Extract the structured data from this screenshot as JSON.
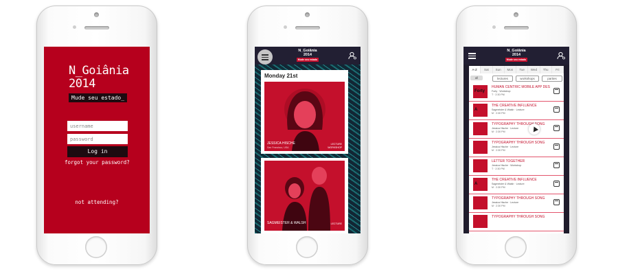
{
  "login": {
    "brand_line1": "N_Goiânia",
    "brand_line2": "2014",
    "tagline": "Mude seu estado_",
    "username_placeholder": "username",
    "password_placeholder": "password",
    "login_label": "Log in",
    "forgot_label": "forgot your password?",
    "not_attending_label": "not attending?"
  },
  "schedule": {
    "header": {
      "logo_line1": "N_Goiânia",
      "logo_line2": "2014",
      "logo_tag": "Mude seu estado"
    },
    "day_title": "Monday 21st",
    "cards": [
      {
        "name": "JESSICA HISCHE",
        "location": "San Francisco, USA",
        "type": "LECTURE",
        "type2": "WORKSHOP"
      },
      {
        "name": "SAGMEISTER & WALSH",
        "type": "LECTURE"
      }
    ]
  },
  "list": {
    "header": {
      "logo_line1": "N_Goiânia",
      "logo_line2": "2014",
      "logo_tag": "Mude seu estado"
    },
    "tabs": [
      "A-Z",
      "Sat",
      "Sun",
      "Mon",
      "Tue",
      "Wed",
      "Thu",
      "Fri"
    ],
    "active_tab": "A-Z",
    "filters": [
      "all",
      "lectures",
      "workshops",
      "parties"
    ],
    "items": [
      {
        "title": "HUMAN CENTRIC MOBILE APP DES",
        "sub": "Forty · Workshop",
        "time": "T · 2:30 PM",
        "thumb": "Forty"
      },
      {
        "title": "THE CREATIVE INFLUENCE",
        "sub": "Sagmeister & Walsh · Lecture",
        "time": "M · 2:30 PM",
        "thumb": "A"
      },
      {
        "title": "TYPOGRAPHY THROUGH SONG",
        "sub": "Jessica Hische · Lecture",
        "time": "M · 2:30 PM",
        "thumb": ""
      },
      {
        "title": "TYPOGRAPHY THROUGH SONG",
        "sub": "Jessica Hische · Lecture",
        "time": "M · 2:30 PM",
        "thumb": ""
      },
      {
        "title": "LETTER TOGETHER",
        "sub": "Jessica Hische · Workshop",
        "time": "T · 2:30 PM",
        "thumb": ""
      },
      {
        "title": "THE CREATIVE INFLUENCE",
        "sub": "Sagmeister & Walsh · Lecture",
        "time": "M · 2:30 PM",
        "thumb": "A"
      },
      {
        "title": "TYPOGRAPHY THROUGH SONG",
        "sub": "Jessica Hische · Lecture",
        "time": "M · 2:30 PM",
        "thumb": ""
      },
      {
        "title": "TYPOGRAPHY THROUGH SONG",
        "sub": "",
        "time": "",
        "thumb": ""
      }
    ]
  },
  "colors": {
    "brand_red": "#b6001d",
    "dark": "#1d0b10",
    "navy": "#221f33"
  }
}
